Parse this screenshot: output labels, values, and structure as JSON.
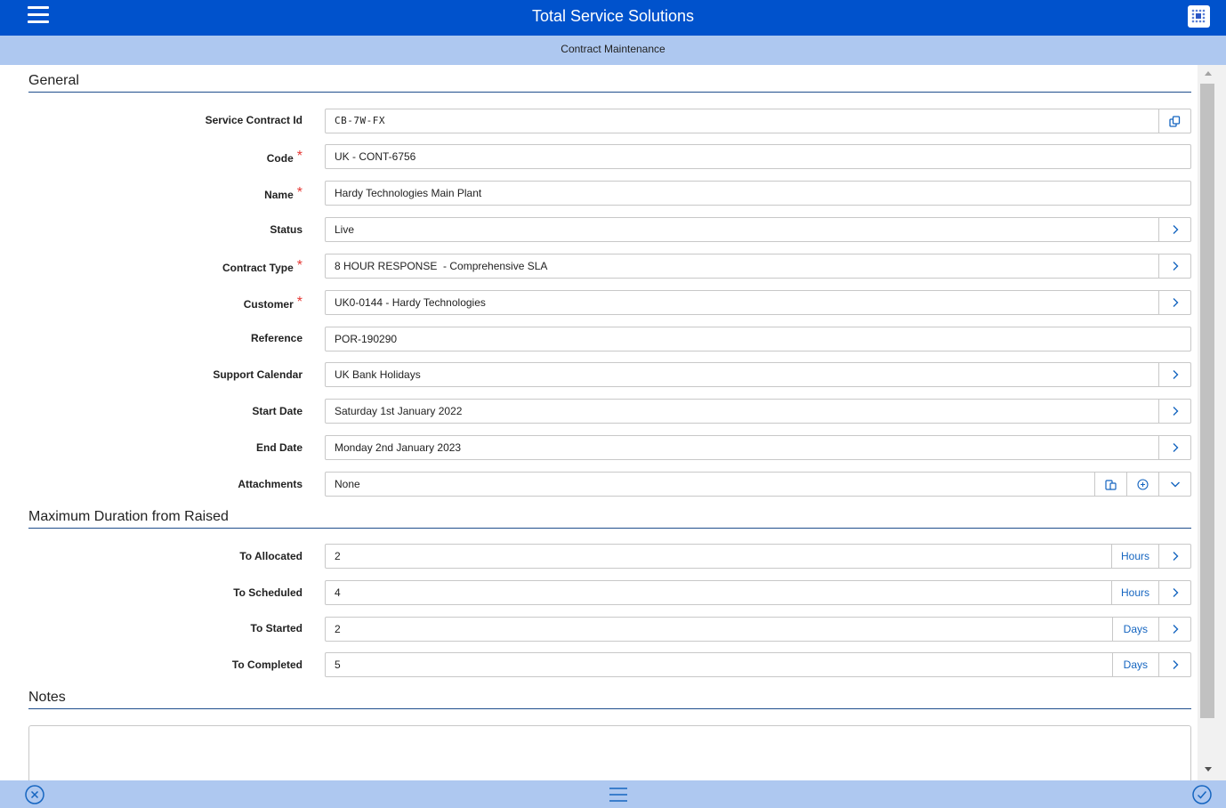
{
  "header": {
    "app_title": "Total Service Solutions",
    "menu_icon": "hamburger-icon",
    "logo_icon": "app-logo-icon",
    "brand_color": "#0052cc"
  },
  "subheader": {
    "page_title": "Contract Maintenance"
  },
  "sections": {
    "general": "General",
    "max_duration": "Maximum Duration from Raised",
    "notes": "Notes"
  },
  "fields": {
    "service_contract_id": {
      "label": "Service Contract Id",
      "value": "CB-7W-FX"
    },
    "code": {
      "label": "Code",
      "value": "UK - CONT-6756"
    },
    "name": {
      "label": "Name",
      "value": "Hardy Technologies Main Plant"
    },
    "status": {
      "label": "Status",
      "value": "Live"
    },
    "contract_type": {
      "label": "Contract Type",
      "value": "8 HOUR RESPONSE  - Comprehensive SLA"
    },
    "customer": {
      "label": "Customer",
      "value": "UK0-0144 - Hardy Technologies"
    },
    "reference": {
      "label": "Reference",
      "value": "POR-190290"
    },
    "support_calendar": {
      "label": "Support Calendar",
      "value": "UK Bank Holidays"
    },
    "start_date": {
      "label": "Start Date",
      "value": "Saturday 1st January 2022"
    },
    "end_date": {
      "label": "End Date",
      "value": "Monday 2nd January 2023"
    },
    "attachments": {
      "label": "Attachments",
      "value": "None"
    }
  },
  "required_marker": "*",
  "durations": {
    "to_allocated": {
      "label": "To Allocated",
      "value": "2",
      "unit": "Hours"
    },
    "to_scheduled": {
      "label": "To Scheduled",
      "value": "4",
      "unit": "Hours"
    },
    "to_started": {
      "label": "To Started",
      "value": "2",
      "unit": "Days"
    },
    "to_completed": {
      "label": "To Completed",
      "value": "5",
      "unit": "Days"
    }
  },
  "notes": {
    "value": ""
  },
  "footer": {
    "cancel_icon": "close-circle-icon",
    "menu_icon": "hamburger-icon",
    "confirm_icon": "check-circle-icon"
  },
  "colors": {
    "accent": "#1565c0",
    "required": "#e53935",
    "bar_light": "#aec8f0"
  }
}
